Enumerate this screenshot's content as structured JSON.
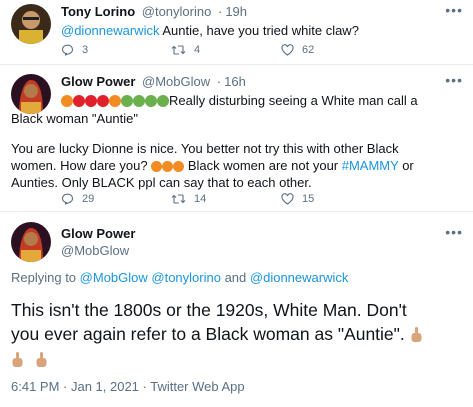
{
  "tweet1": {
    "name": "Tony Lorino",
    "handle": "@tonylorino",
    "time": "19h",
    "mention": "@dionnewarwick",
    "text": "Auntie, have you tried white claw?",
    "replies": "3",
    "retweets": "4",
    "likes": "62",
    "more": "•••"
  },
  "tweet2": {
    "name": "Glow Power",
    "handle": "@MobGlow",
    "time": "16h",
    "line1": "Really disturbing seeing a White man call a",
    "line2": "Black woman \"Auntie\"",
    "line3": "You are lucky Dionne is nice. You better not try this with other Black",
    "line4a": "women. How dare you?",
    "line4b": "Black women are not your",
    "hashtag": "#MAMMY",
    "line4c": "or",
    "line5": "Aunties. Only BLACK ppl can say that to each other.",
    "replies": "29",
    "retweets": "14",
    "likes": "15",
    "more": "•••"
  },
  "tweet3": {
    "name": "Glow Power",
    "handle": "@MobGlow",
    "replying_prefix": "Replying to",
    "replying_to": "@MobGlow @tonylorino",
    "replying_and": "and",
    "replying_last": "@dionnewarwick",
    "text_line1": "This isn't the 1800s or the 1920s, White Man.  Don't",
    "text_line2": "you ever again refer to a Black woman as \"Auntie\".",
    "timestamp": "6:41 PM · Jan 1, 2021 · Twitter Web App",
    "more": "•••"
  },
  "colors": {
    "link": "#1b95e0",
    "muted": "#5b7083",
    "divider": "#e6ecf0"
  },
  "icons": [
    "reply-icon",
    "retweet-icon",
    "like-icon",
    "more-icon",
    "middle-finger-emoji",
    "angry-face-emoji",
    "green-sick-face-emoji"
  ]
}
